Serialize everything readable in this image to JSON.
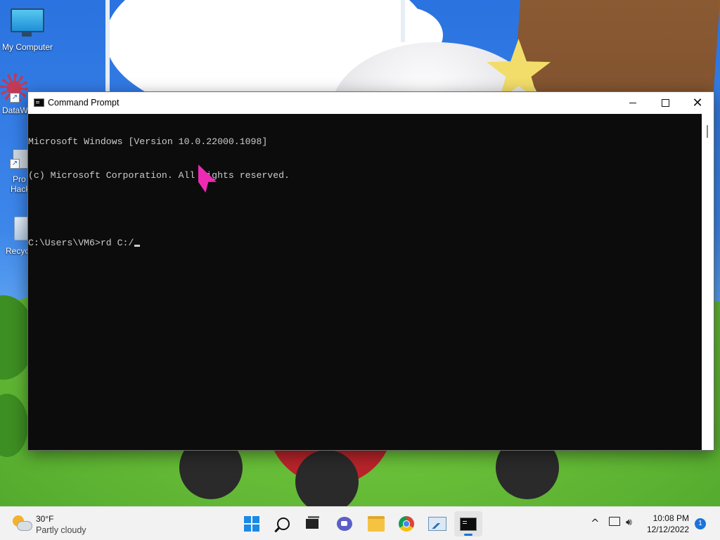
{
  "desktop": {
    "icons": [
      {
        "label": "My Computer"
      },
      {
        "label": "DataW"
      },
      {
        "label": "Pro"
      },
      {
        "label": "Hack"
      },
      {
        "label": "Recyc"
      }
    ]
  },
  "window": {
    "title": "Command Prompt",
    "close_glyph": "✕"
  },
  "console": {
    "lines": [
      "Microsoft Windows [Version 10.0.22000.1098]",
      "(c) Microsoft Corporation. All rights reserved.",
      "",
      "C:\\Users\\VM6>rd C:/"
    ]
  },
  "taskbar": {
    "weather": {
      "temp": "30°F",
      "desc": "Partly cloudy"
    },
    "apps": [
      {
        "name": "start-button"
      },
      {
        "name": "search-button"
      },
      {
        "name": "task-view-button"
      },
      {
        "name": "chat-button"
      },
      {
        "name": "file-explorer-button"
      },
      {
        "name": "chrome-button"
      },
      {
        "name": "performance-monitor-button"
      },
      {
        "name": "command-prompt-button"
      }
    ],
    "tray": {
      "chevron": "^",
      "clock_time": "10:08 PM",
      "clock_date": "12/12/2022",
      "notification_count": "1"
    }
  },
  "colors": {
    "accent": "#1a73d9",
    "console_bg": "#0c0c0c",
    "console_text": "#cccccc",
    "pointer": "#ee2ab4"
  }
}
